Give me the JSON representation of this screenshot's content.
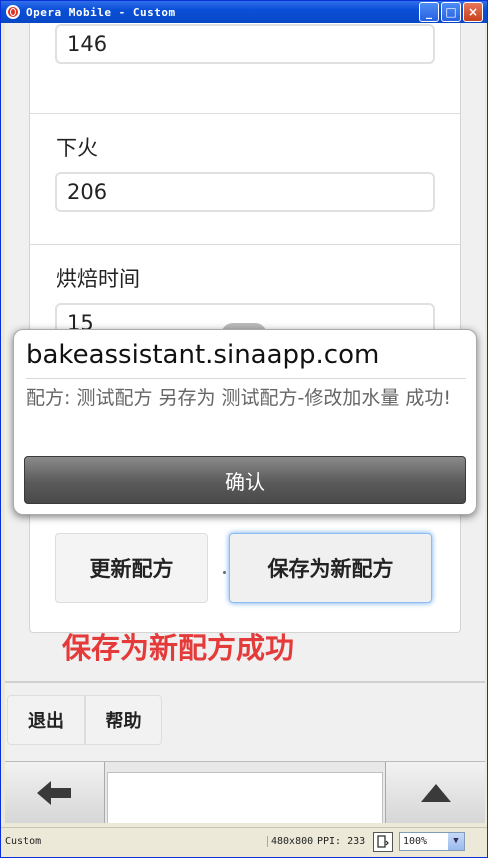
{
  "window": {
    "title": "Opera Mobile - Custom",
    "minimize_glyph": "_",
    "maximize_glyph": "□",
    "close_glyph": "×"
  },
  "form": {
    "upper_heat_value": "146",
    "lower_heat_label": "下火",
    "lower_heat_value": "206",
    "bake_time_label": "烘焙时间",
    "bake_time_value": "15"
  },
  "actions": {
    "update_label": "更新配方",
    "save_new_label": "保存为新配方",
    "success_message": "保存为新配方成功"
  },
  "footer_nav": {
    "exit_label": "退出",
    "help_label": "帮助"
  },
  "dialog": {
    "host": "bakeassistant.sinaapp.com",
    "message": "配方: 测试配方 另存为 测试配方-修改加水量 成功!",
    "ok_label": "确认"
  },
  "statusbar": {
    "profile": "Custom",
    "resolution": "480x800",
    "ppi": "PPI: 233",
    "zoom": "100%"
  },
  "colors": {
    "titlebar": "#0a4fd8",
    "success": "#e53a3a",
    "focus_ring": "#6aa7f0"
  }
}
